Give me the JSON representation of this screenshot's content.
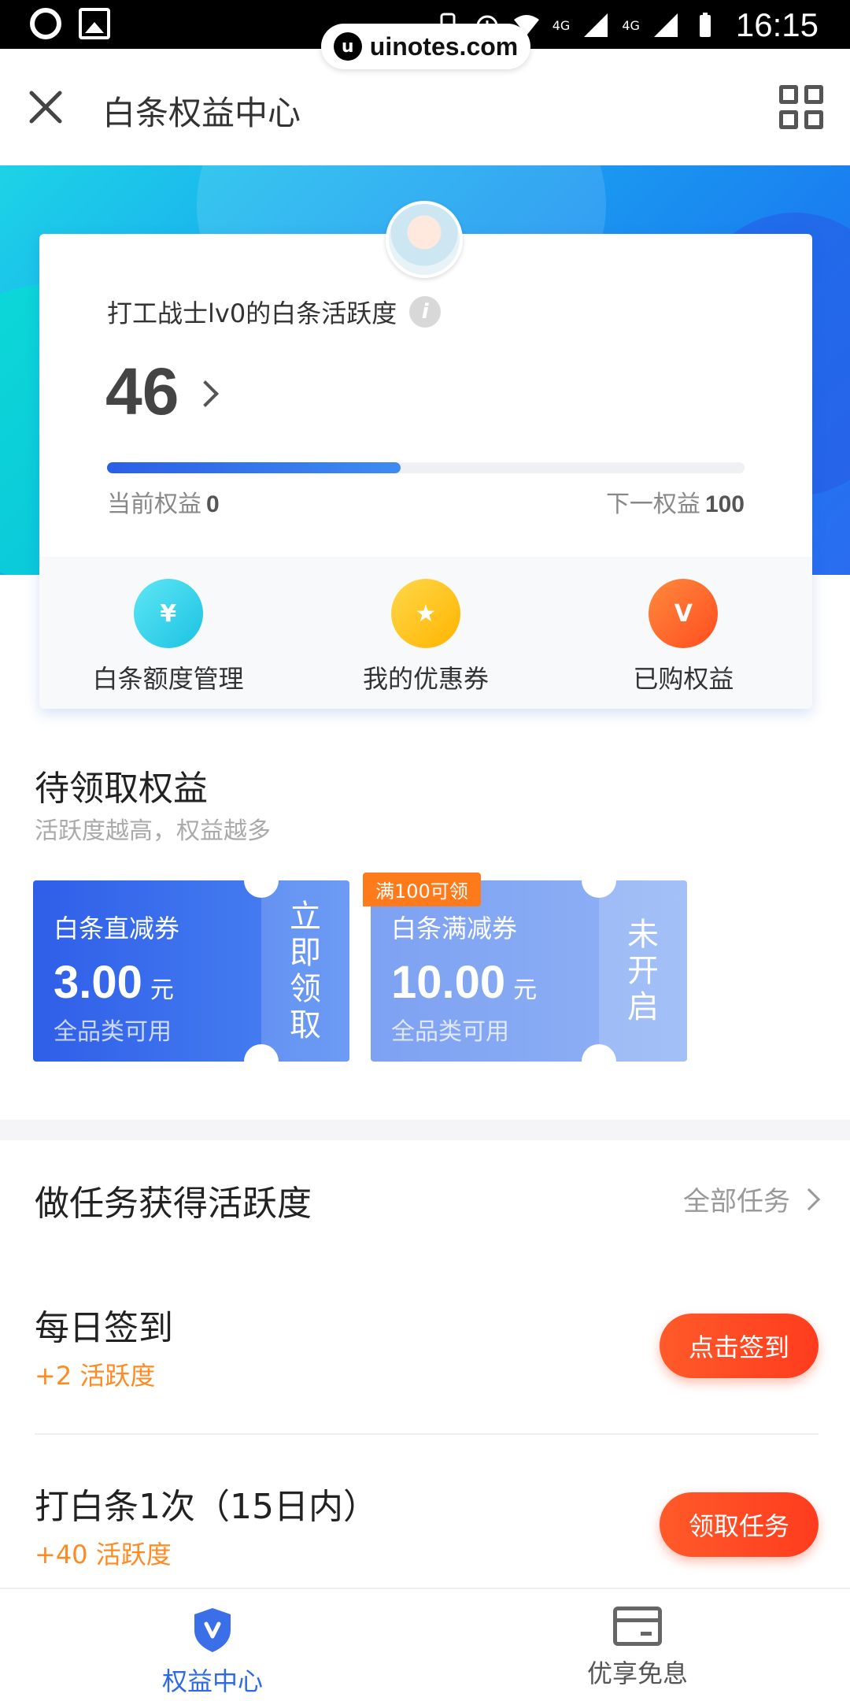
{
  "status_bar": {
    "time": "16:15",
    "net1": "4G",
    "net2": "4G"
  },
  "watermark": {
    "logo": "u",
    "text": "uinotes.com"
  },
  "header": {
    "title": "白条权益中心",
    "close_icon": "close-icon",
    "menu_icon": "grid-icon"
  },
  "card": {
    "activity_label": "打工战士lv0的白条活跃度",
    "score": "46",
    "progress_fraction": 0.46,
    "current_label": "当前权益",
    "current_value": "0",
    "next_label": "下一权益",
    "next_value": "100",
    "quick_actions": [
      {
        "label": "白条额度管理",
        "icon": "wallet-yen-icon",
        "color": "#1cc2e3"
      },
      {
        "label": "我的优惠券",
        "icon": "coupon-ticket-icon",
        "color": "#ffb400"
      },
      {
        "label": "已购权益",
        "icon": "v-card-icon",
        "color": "#ff4d1f"
      }
    ]
  },
  "pending": {
    "title": "待领取权益",
    "subtitle": "活跃度越高，权益越多",
    "coupons": [
      {
        "title": "白条直减券",
        "amount": "3.00",
        "unit": "元",
        "scope": "全品类可用",
        "action": [
          "立",
          "即",
          "领",
          "取"
        ]
      },
      {
        "badge": "满100可领",
        "title": "白条满减券",
        "amount": "10.00",
        "unit": "元",
        "scope": "全品类可用",
        "action": [
          "未",
          "开",
          "启"
        ]
      }
    ]
  },
  "tasks": {
    "title": "做任务获得活跃度",
    "all_label": "全部任务",
    "items": [
      {
        "name": "每日签到",
        "reward": "+2 活跃度",
        "button": "点击签到"
      },
      {
        "name": "打白条1次（15日内）",
        "reward": "+40 活跃度",
        "button": "领取任务"
      }
    ]
  },
  "nav": {
    "items": [
      {
        "label": "权益中心",
        "icon": "shield-v-icon",
        "active": true
      },
      {
        "label": "优享免息",
        "icon": "card-icon",
        "active": false
      }
    ]
  },
  "colors": {
    "accent": "#2e6ae6",
    "orange": "#ff8a22",
    "button": "#ff4a24"
  }
}
